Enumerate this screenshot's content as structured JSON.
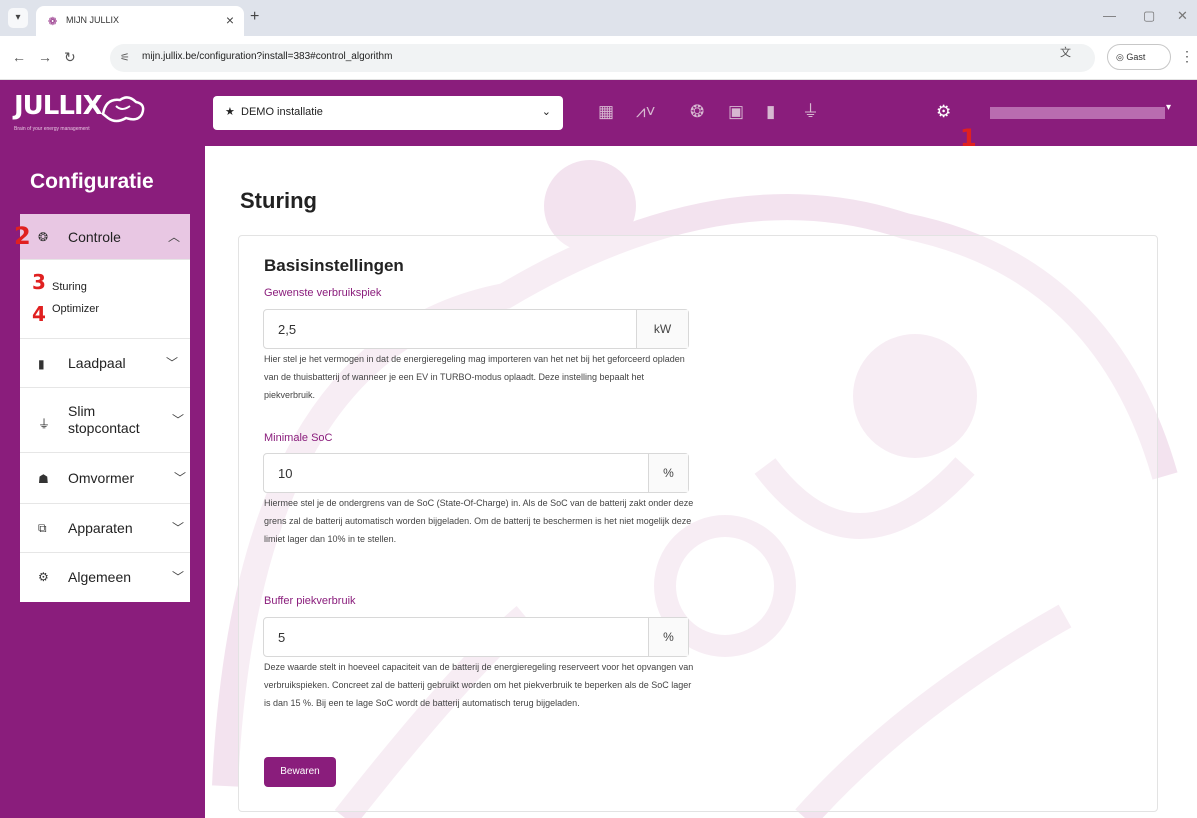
{
  "browser": {
    "tab_title": "MIJN JULLIX",
    "tab_close": "×",
    "new_tab": "+",
    "url": "mijn.jullix.be/configuration?install=383#control_algorithm",
    "guest_label": "Gast"
  },
  "header": {
    "logo_text": "JULLIX",
    "logo_sub": "Brain of your energy management",
    "installation_select": "DEMO installatie",
    "icons": [
      "dashboard-icon",
      "chart-icon",
      "brain-icon",
      "money-icon",
      "charger-icon",
      "plug-icon",
      "gear-icon"
    ],
    "brand_color": "#8a1d7c"
  },
  "markers": {
    "m1": "1",
    "m2": "2",
    "m3": "3",
    "m4": "4"
  },
  "sidebar": {
    "title": "Configuratie",
    "items": [
      {
        "label": "Controle",
        "icon": "brain-icon",
        "expanded": true,
        "subitems": [
          "Sturing",
          "Optimizer"
        ]
      },
      {
        "label": "Laadpaal",
        "icon": "charger-icon"
      },
      {
        "label": "Slim stopcontact",
        "icon": "plug-icon"
      },
      {
        "label": "Omvormer",
        "icon": "solar-icon"
      },
      {
        "label": "Apparaten",
        "icon": "devices-icon"
      },
      {
        "label": "Algemeen",
        "icon": "gear-icon"
      }
    ],
    "slim_line1": "Slim",
    "slim_line2": "stopcontact"
  },
  "main": {
    "page_title": "Sturing",
    "section_title": "Basisinstellingen",
    "fields": [
      {
        "label": "Gewenste verbruikspiek",
        "value": "2,5",
        "unit": "kW",
        "help": "Hier stel je het vermogen in dat de energieregeling mag importeren van het net bij het geforceerd opladen van de thuisbatterij of wanneer je een EV in TURBO-modus oplaadt. Deze instelling bepaalt het piekverbruik."
      },
      {
        "label": "Minimale SoC",
        "value": "10",
        "unit": "%",
        "help": "Hiermee stel je de ondergrens van de SoC (State-Of-Charge) in. Als de SoC van de batterij zakt onder deze grens zal de batterij automatisch worden bijgeladen. Om de batterij te beschermen is het niet mogelijk deze limiet lager dan 10% in te stellen."
      },
      {
        "label": "Buffer piekverbruik",
        "value": "5",
        "unit": "%",
        "help": "Deze waarde stelt in hoeveel capaciteit van de batterij de energieregeling reserveert voor het opvangen van verbruikspieken. Concreet zal de batterij gebruikt worden om het piekverbruik te beperken als de SoC lager is dan 15 %. Bij een te lage SoC wordt de batterij automatisch terug bijgeladen."
      }
    ],
    "save_label": "Bewaren"
  }
}
